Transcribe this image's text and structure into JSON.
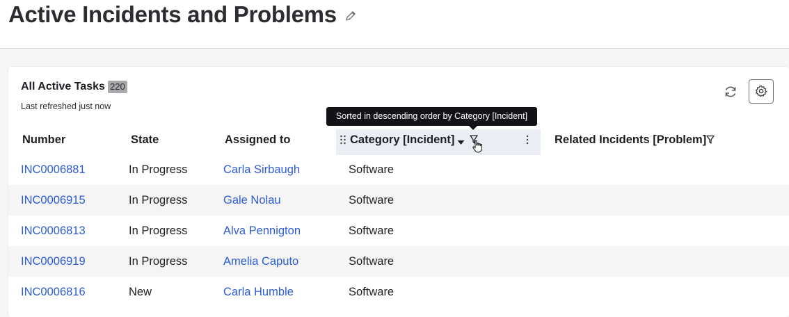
{
  "page": {
    "title": "Active Incidents and Problems"
  },
  "list": {
    "title": "All Active Tasks",
    "count": "220",
    "refresh_status": "Last refreshed just now",
    "tooltip": "Sorted in descending order by Category [Incident]",
    "sort_direction": "descending",
    "columns": {
      "number": "Number",
      "state": "State",
      "assigned_to": "Assigned to",
      "category": "Category [Incident]",
      "related": "Related Incidents [Problem]"
    },
    "rows": [
      {
        "number": "INC0006881",
        "state": "In Progress",
        "assigned_to": "Carla Sirbaugh",
        "category": "Software"
      },
      {
        "number": "INC0006915",
        "state": "In Progress",
        "assigned_to": "Gale Nolau",
        "category": "Software"
      },
      {
        "number": "INC0006813",
        "state": "In Progress",
        "assigned_to": "Alva Pennigton",
        "category": "Software"
      },
      {
        "number": "INC0006919",
        "state": "In Progress",
        "assigned_to": "Amelia Caputo",
        "category": "Software"
      },
      {
        "number": "INC0006816",
        "state": "New",
        "assigned_to": "Carla Humble",
        "category": "Software"
      }
    ]
  },
  "icons": {
    "edit": "pencil-icon",
    "refresh": "refresh-icon",
    "settings": "gear-icon",
    "drag": "drag-handle-icon",
    "sort": "caret-down-icon",
    "filter": "funnel-icon",
    "more": "kebab-icon",
    "cursor": "hand-pointer-icon"
  },
  "colors": {
    "link": "#2d5bd8",
    "active_column_bg": "#eaedf4",
    "tooltip_bg": "#121316",
    "badge_bg": "#a8a9ad",
    "alt_row_bg": "#f5f5f6"
  }
}
